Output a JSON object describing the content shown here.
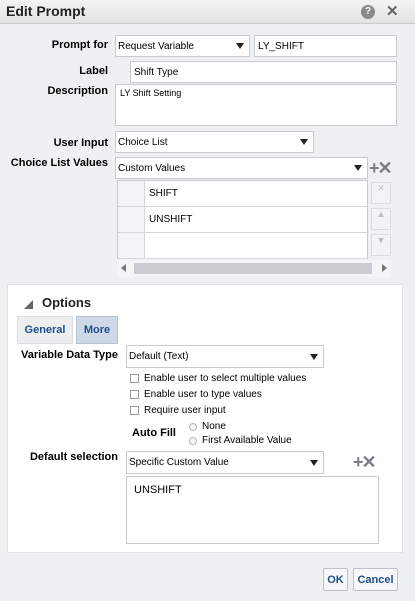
{
  "dialog": {
    "title": "Edit Prompt"
  },
  "form": {
    "prompt_for_label": "Prompt for",
    "prompt_for_value": "Request Variable",
    "variable_name": "LY_SHIFT",
    "label_label": "Label",
    "label_value": "Shift Type",
    "description_label": "Description",
    "description_value": "LY Shift Setting",
    "user_input_label": "User Input",
    "user_input_value": "Choice List",
    "choice_list_label": "Choice List Values",
    "choice_list_value": "Custom Values",
    "choice_values": [
      "SHIFT",
      "UNSHIFT",
      ""
    ]
  },
  "options": {
    "heading": "Options",
    "tabs": [
      "General",
      "More"
    ],
    "variable_data_type_label": "Variable Data Type",
    "variable_data_type_value": "Default (Text)",
    "checkboxes": [
      "Enable user to select multiple values",
      "Enable user to type values",
      "Require user input"
    ],
    "auto_fill_label": "Auto Fill",
    "auto_fill_options": [
      "None",
      "First Available Value"
    ],
    "default_selection_label": "Default selection",
    "default_selection_value": "Specific Custom Value",
    "default_value": "UNSHIFT"
  },
  "buttons": {
    "ok": "OK",
    "cancel": "Cancel"
  }
}
